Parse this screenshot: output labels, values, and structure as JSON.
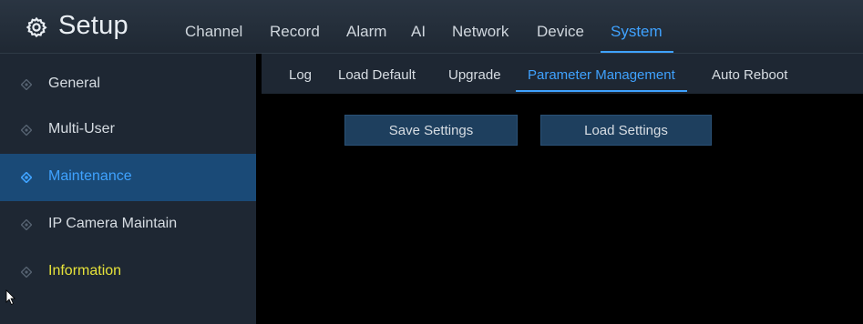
{
  "header": {
    "title": "Setup",
    "icon": "gear-icon",
    "tabs": [
      {
        "label": "Channel",
        "active": false
      },
      {
        "label": "Record",
        "active": false
      },
      {
        "label": "Alarm",
        "active": false
      },
      {
        "label": "AI",
        "active": false
      },
      {
        "label": "Network",
        "active": false
      },
      {
        "label": "Device",
        "active": false
      },
      {
        "label": "System",
        "active": true
      }
    ]
  },
  "sidebar": {
    "items": [
      {
        "label": "General",
        "icon": "diamond-icon",
        "active": false
      },
      {
        "label": "Multi-User",
        "icon": "diamond-icon",
        "active": false
      },
      {
        "label": "Maintenance",
        "icon": "diamond-icon",
        "active": true
      },
      {
        "label": "IP Camera Maintain",
        "icon": "diamond-icon",
        "active": false
      },
      {
        "label": "Information",
        "icon": "diamond-icon",
        "active": false
      }
    ]
  },
  "subnav": {
    "tabs": [
      {
        "label": "Log",
        "active": false
      },
      {
        "label": "Load Default",
        "active": false
      },
      {
        "label": "Upgrade",
        "active": false
      },
      {
        "label": "Parameter Management",
        "active": true
      },
      {
        "label": "Auto Reboot",
        "active": false
      }
    ]
  },
  "actions": {
    "save_label": "Save Settings",
    "load_label": "Load Settings"
  },
  "colors": {
    "accent": "#3fa2ff",
    "info_text": "#e6e23a",
    "active_sidebar_bg": "#1a4a77",
    "button_bg": "#1e3f5e"
  }
}
